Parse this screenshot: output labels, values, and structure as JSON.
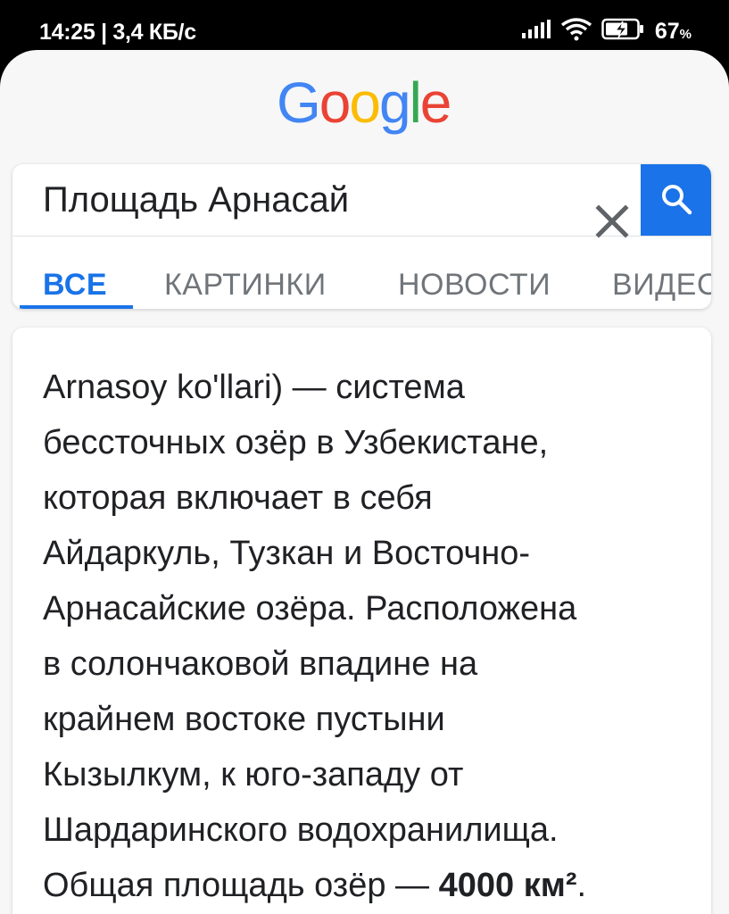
{
  "status_bar": {
    "time_speed": "14:25 | 3,4 КБ/с",
    "battery_percent": "67",
    "battery_percent_sign": "%",
    "icons": [
      "signal-icon",
      "wifi-icon",
      "battery-charging-icon"
    ]
  },
  "logo": {
    "letters": [
      "G",
      "o",
      "o",
      "g",
      "l",
      "e"
    ],
    "colors": [
      "#4285F4",
      "#EA4335",
      "#FBBC05",
      "#4285F4",
      "#34A853",
      "#EA4335"
    ]
  },
  "search": {
    "query": "Площадь Арнасай",
    "clear_icon": "close-icon",
    "search_icon": "search-icon",
    "accent": "#1a73e8"
  },
  "tabs": [
    {
      "label": "ВСЕ",
      "active": true
    },
    {
      "label": "КАРТИНКИ",
      "active": false
    },
    {
      "label": "НОВОСТИ",
      "active": false
    },
    {
      "label": "ВИДЕС",
      "active": false
    }
  ],
  "result": {
    "lines": [
      "Arnasoy ko'llari) — система",
      "бессточных озёр в Узбекистане,",
      "которая включает в себя",
      "Айдаркуль, Тузкан и Восточно-",
      "Арнасайские озёра. Расположена",
      "в солончаковой впадине на",
      "крайнем востоке пустыни",
      "Кызылкум, к юго-западу от",
      "Шардаринского водохранилища."
    ],
    "last_line_prefix": "Общая площадь озёр — ",
    "last_line_bold": "4000 км²",
    "last_line_suffix": "."
  }
}
